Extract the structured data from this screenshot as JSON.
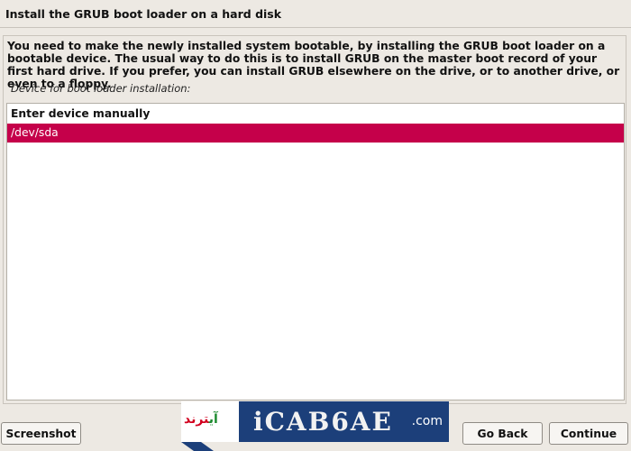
{
  "window": {
    "title": "Install the GRUB boot loader on a hard disk"
  },
  "main": {
    "description": "You need to make the newly installed system bootable, by installing the GRUB boot loader on a bootable device. The usual way to do this is to install GRUB on the master boot record of your first hard drive. If you prefer, you can install GRUB elsewhere on the drive, or to another drive, or even to a floppy.",
    "prompt_label": "Device for boot loader installation:",
    "devices": [
      {
        "label": "Enter device manually",
        "selected": false
      },
      {
        "label": "/dev/sda",
        "selected": true
      }
    ]
  },
  "buttons": {
    "screenshot": "Screenshot",
    "go_back": "Go Back",
    "continue": "Continue"
  },
  "colors": {
    "selection": "#c5004a",
    "background": "#ede9e3",
    "watermark_bar": "#1c3f7a"
  },
  "watermark": {
    "persian_text": "آی‌ترند",
    "letters": "iCAB6AE",
    "suffix": ".com"
  }
}
